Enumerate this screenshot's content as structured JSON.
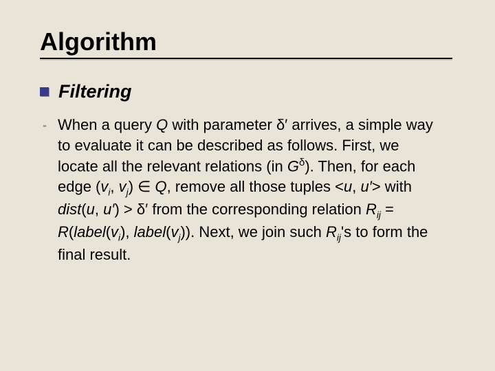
{
  "title": "Algorithm",
  "subhead": "Filtering",
  "body": {
    "t1": "When a query ",
    "Q": "Q",
    "t2": " with parameter ",
    "deltaPrime1": "δ′",
    "t3": " arrives, a simple way to evaluate it can be described as follows. First, we locate all the relevant relations (in ",
    "G": "G",
    "delta_sup": "δ",
    "t4": "). Then, for each edge (",
    "vi": "v",
    "i": "i",
    "comma1": ", ",
    "vj": "v",
    "j": "j",
    "t5": ") ",
    "in": "∈",
    "sp1": " ",
    "Q2": "Q",
    "t6": ", remove all those tuples <",
    "u1": "u",
    "comma2": ", ",
    "u2": "u′",
    "t7": "> with ",
    "dist": "dist",
    "lp": "(",
    "u3": "u",
    "comma3": ", ",
    "u4": "u′",
    "rp": ")",
    "t8": " > ",
    "deltaPrime2": "δ′",
    "t9": " from the corresponding relation ",
    "Rij": "R",
    "ij": "ij",
    "t10": " = ",
    "R": "R",
    "lp2": "(",
    "label1": "label",
    "lp3": "(",
    "vi2": "v",
    "i2": "i",
    "rp2": ")",
    "comma4": ", ",
    "label2": "label",
    "lp4": "(",
    "vj2": "v",
    "j2": "j",
    "rp3": "))",
    "t11": ". Next, we join such ",
    "Rij2": "R",
    "ij2": "ij",
    "t12": "'s to form the final result."
  }
}
